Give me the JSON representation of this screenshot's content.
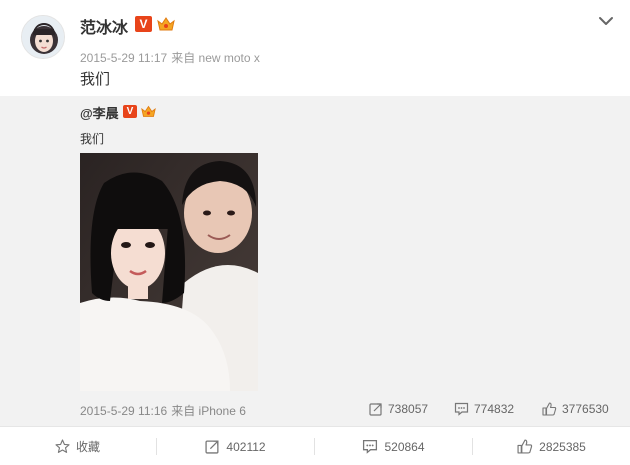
{
  "post": {
    "author": "范冰冰",
    "vip_label": "V",
    "date": "2015-5-29 11:17",
    "source": "来自 new moto x",
    "text": "我们"
  },
  "repost": {
    "author": "@李晨",
    "vip_label": "V",
    "text": "我们",
    "date": "2015-5-29 11:16",
    "source": "来自 iPhone 6",
    "forward_count": "738057",
    "comment_count": "774832",
    "like_count": "3776530"
  },
  "actions": {
    "favorite_label": "收藏",
    "forward_count": "402112",
    "comment_count": "520864",
    "like_count": "2825385"
  },
  "colors": {
    "vip_badge": "#e8441a",
    "repost_background": "#f2f2f2",
    "meta_text": "#9a9a9a"
  },
  "icons": [
    "avatar",
    "vip-badge",
    "member-crown-icon",
    "chevron-down-icon",
    "star-icon",
    "forward-icon",
    "comment-icon",
    "thumbs-up-icon"
  ]
}
